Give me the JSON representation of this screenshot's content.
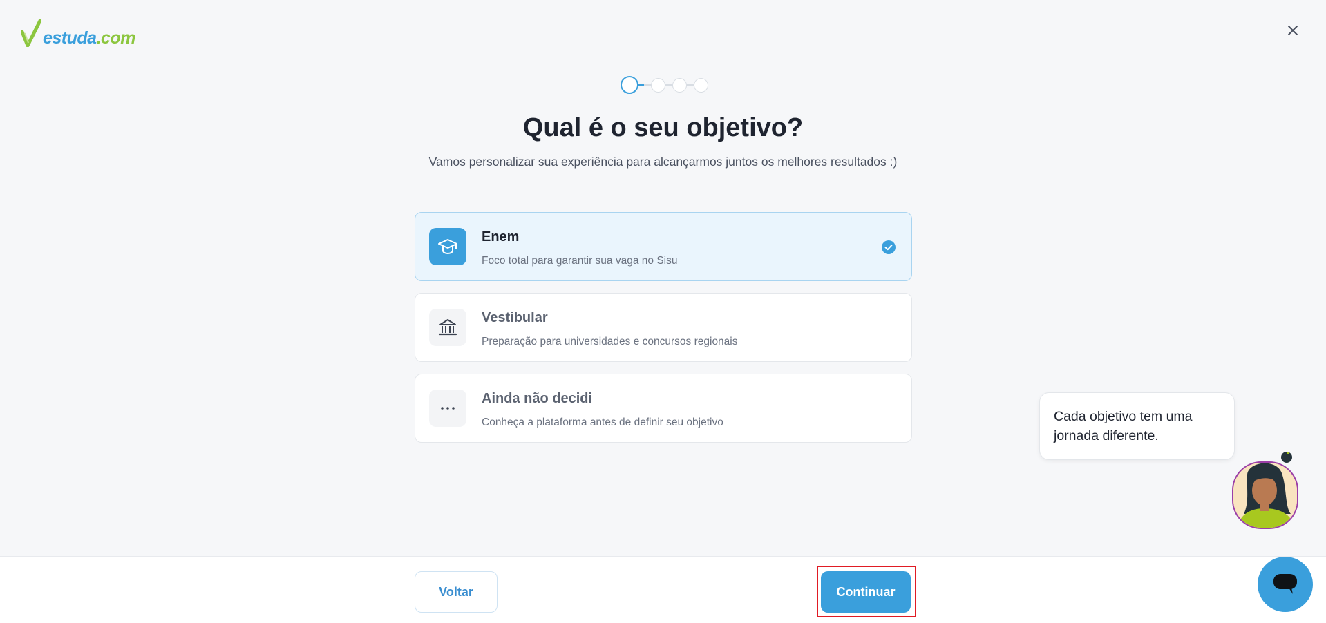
{
  "brand": {
    "logo_part1": "estuda",
    "logo_part2": ".com",
    "blue": "#3a9fdc",
    "green": "#8cc63f"
  },
  "header": {
    "close_icon": "close-icon"
  },
  "stepper": {
    "total_steps": 4,
    "current_step": 1
  },
  "heading": {
    "title": "Qual é o seu objetivo?",
    "subtitle": "Vamos personalizar sua experiência para alcançarmos juntos os melhores resultados :)"
  },
  "options": [
    {
      "title": "Enem",
      "description": "Foco total para garantir sua vaga no Sisu",
      "icon": "graduation-cap-icon",
      "selected": true
    },
    {
      "title": "Vestibular",
      "description": "Preparação para universidades e concursos regionais",
      "icon": "university-building-icon",
      "selected": false
    },
    {
      "title": "Ainda não decidi",
      "description": "Conheça a plataforma antes de definir seu objetivo",
      "icon": "more-dots-icon",
      "selected": false
    }
  ],
  "footer": {
    "back_label": "Voltar",
    "continue_label": "Continuar"
  },
  "assistant": {
    "message": "Cada objetivo tem uma jornada diferente.",
    "avatar": "assistant-avatar",
    "chat_icon": "chat-bubble-icon"
  }
}
